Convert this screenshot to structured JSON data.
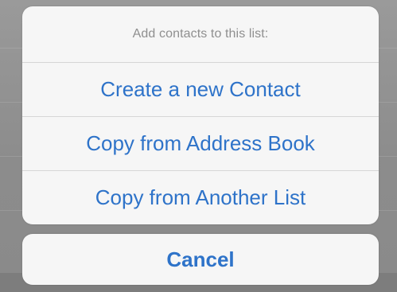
{
  "action_sheet": {
    "title": "Add contacts to this list:",
    "options": [
      {
        "label": "Create a new Contact"
      },
      {
        "label": "Copy from Address Book"
      },
      {
        "label": "Copy from Another List"
      }
    ],
    "cancel_label": "Cancel"
  },
  "colors": {
    "accent": "#2e73c9",
    "title_text": "#8f8f8f",
    "sheet_background": "#f6f6f6",
    "dimmed_backdrop": "#8e8e8e"
  }
}
